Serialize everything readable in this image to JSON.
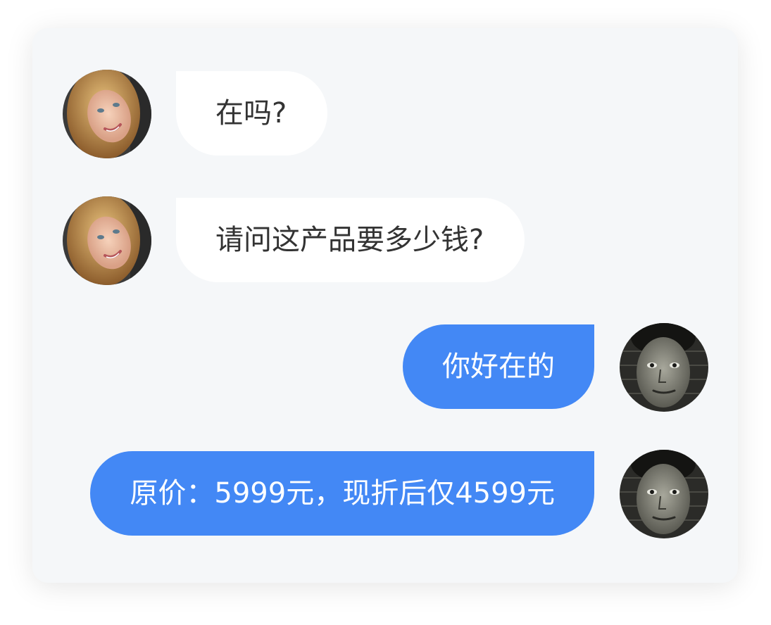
{
  "chat": {
    "messages": [
      {
        "direction": "incoming",
        "sender_avatar": "woman-avatar",
        "text": "在吗?"
      },
      {
        "direction": "incoming",
        "sender_avatar": "woman-avatar",
        "text": "请问这产品要多少钱?"
      },
      {
        "direction": "outgoing",
        "sender_avatar": "man-avatar",
        "text": "你好在的"
      },
      {
        "direction": "outgoing",
        "sender_avatar": "man-avatar",
        "text": "原价：5999元，现折后仅4599元"
      }
    ]
  },
  "colors": {
    "background": "#ffffff",
    "panel": "#f5f7f9",
    "incoming_bubble": "#ffffff",
    "incoming_text": "#333333",
    "outgoing_bubble": "#4388f5",
    "outgoing_text": "#ffffff"
  }
}
